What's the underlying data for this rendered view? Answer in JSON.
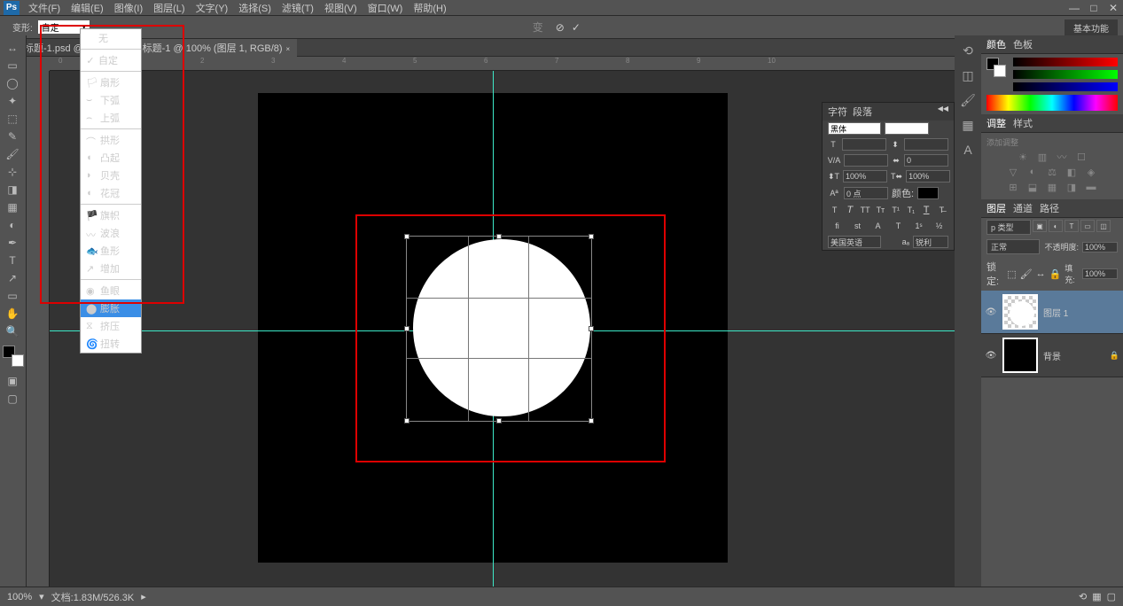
{
  "menubar": {
    "items": [
      "文件(F)",
      "编辑(E)",
      "图像(I)",
      "图层(L)",
      "文字(Y)",
      "选择(S)",
      "滤镜(T)",
      "视图(V)",
      "窗口(W)",
      "帮助(H)"
    ]
  },
  "winbtns": {
    "min": "—",
    "max": "□",
    "close": "✕"
  },
  "optionbar": {
    "label": "变形:",
    "dropdown": "自定",
    "right": "基本功能"
  },
  "tabs": [
    {
      "label": "未标题-1.psd @ 100%",
      "close": "×"
    },
    {
      "label": "未标题-1 @ 100% (图层 1, RGB/8)",
      "close": "×",
      "active": true
    }
  ],
  "ruler_ticks": [
    "0",
    "1",
    "2",
    "3",
    "4",
    "5",
    "6",
    "7",
    "8",
    "9",
    "10"
  ],
  "zoom": "100%",
  "docinfo": "文档:1.83M/526.3K",
  "dropdown": {
    "top": [
      "无",
      "自定"
    ],
    "g1": [
      "扇形",
      "下弧",
      "上弧"
    ],
    "g2": [
      "拱形",
      "凸起",
      "贝壳",
      "花冠"
    ],
    "g3": [
      "旗帜",
      "波浪",
      "鱼形",
      "增加"
    ],
    "g4": [
      "鱼眼",
      "膨胀",
      "挤压",
      "扭转"
    ],
    "selected": "膨胀",
    "checked": "自定"
  },
  "rpanel": {
    "color_hdr": [
      "颜色",
      "色板"
    ],
    "adjust_hdr": [
      "调整",
      "样式"
    ],
    "adjust_label": "添加调整",
    "layers_hdr": [
      "图层",
      "通道",
      "路径"
    ],
    "layers": {
      "type_label": "p 类型",
      "blend": "正常",
      "opacity_label": "不透明度:",
      "opacity": "100%",
      "lock_label": "锁定:",
      "fill_label": "填充:",
      "fill": "100%"
    },
    "layerlist": [
      {
        "name": "图层 1",
        "sel": true
      },
      {
        "name": "背景",
        "lock": "🔒"
      }
    ]
  },
  "char_panel": {
    "hdr": [
      "字符",
      "段落"
    ],
    "font": "黑体",
    "style": "",
    "size": "",
    "leading": "",
    "tracking": "0",
    "kerning": "",
    "vscale": "100%",
    "hscale": "100%",
    "baseline": "0 点",
    "color_label": "颜色:",
    "lang": "美国英语",
    "aa": "锐利"
  },
  "tools": [
    "▤",
    "◻",
    "◯",
    "✥",
    "⬚",
    "✎",
    "✏",
    "⟋",
    "⊹",
    "◐",
    "T",
    "▭",
    "✋",
    "🔍"
  ]
}
